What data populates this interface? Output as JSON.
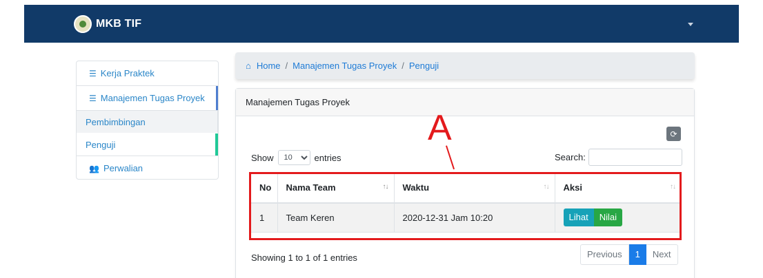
{
  "navbar": {
    "brand": "MKB TIF",
    "background": "#113a68"
  },
  "sidebar": {
    "items": [
      {
        "label": "Kerja Praktek",
        "icon": "tasks-icon"
      },
      {
        "label": "Manajemen Tugas Proyek",
        "icon": "tasks-icon"
      },
      {
        "label": "Pembimbingan"
      },
      {
        "label": "Penguji"
      },
      {
        "label": "Perwalian",
        "icon": "users-icon"
      }
    ]
  },
  "breadcrumb": {
    "home": "Home",
    "level1": "Manajemen Tugas Proyek",
    "level2": "Penguji",
    "separator": "/"
  },
  "card": {
    "title": "Manajemen Tugas Proyek"
  },
  "table_controls": {
    "show_label": "Show",
    "entries_value": "10",
    "entries_label": "entries",
    "search_label": "Search:",
    "search_value": ""
  },
  "table": {
    "columns": [
      "No",
      "Nama Team",
      "Waktu",
      "Aksi"
    ],
    "rows": [
      {
        "no": "1",
        "team": "Team Keren",
        "waktu": "2020-12-31 Jam 10:20"
      }
    ],
    "actions": {
      "view": "Lihat",
      "grade": "Nilai"
    }
  },
  "footer": {
    "info": "Showing 1 to 1 of 1 entries",
    "prev": "Previous",
    "page": "1",
    "next": "Next"
  },
  "annotation": {
    "letter": "A",
    "color": "#e31a1c"
  },
  "colors": {
    "accent": "#1e7bd6",
    "info": "#17a2b8",
    "success": "#28a745",
    "active_indicator": "#20c997"
  }
}
